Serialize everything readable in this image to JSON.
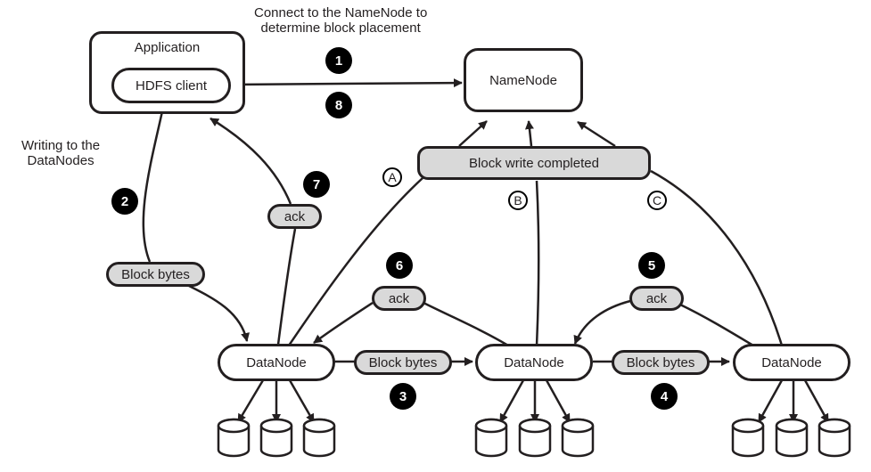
{
  "diagram": {
    "title_note": [
      "Connect to the NameNode to",
      "determine block placement"
    ],
    "side_note": [
      "Writing to the",
      "DataNodes"
    ],
    "application": {
      "label": "Application",
      "client_label": "HDFS client"
    },
    "namenode": {
      "label": "NameNode"
    },
    "block_write_completed": {
      "label": "Block write completed"
    },
    "datanodes": [
      {
        "label": "DataNode"
      },
      {
        "label": "DataNode"
      },
      {
        "label": "DataNode"
      }
    ],
    "block_bytes_labels": [
      "Block bytes",
      "Block bytes",
      "Block bytes"
    ],
    "ack_labels": [
      "ack",
      "ack",
      "ack"
    ],
    "steps": [
      "1",
      "2",
      "3",
      "4",
      "5",
      "6",
      "7",
      "8"
    ],
    "confirmations": [
      "A",
      "B",
      "C"
    ],
    "colors": {
      "stroke": "#231f20",
      "pill_fill": "#d9d9d9",
      "badge_fill": "#000000"
    }
  }
}
